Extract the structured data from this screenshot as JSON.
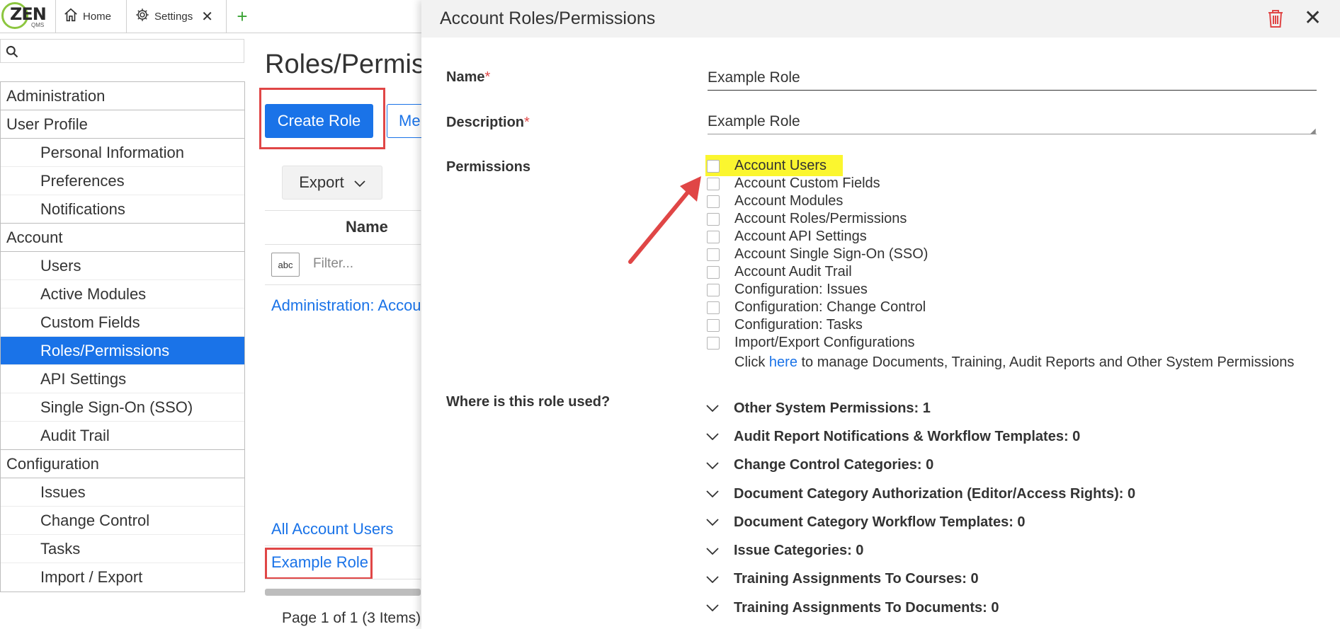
{
  "topbar": {
    "logo_text": "ZEN",
    "logo_sub": "QMS",
    "tabs": [
      {
        "label": "Home",
        "icon": "home-icon"
      },
      {
        "label": "Settings",
        "icon": "gear-icon"
      }
    ]
  },
  "sidebar": {
    "search_placeholder": "",
    "items": [
      {
        "label": "Administration"
      },
      {
        "label": "User Profile"
      },
      {
        "label": "Personal Information"
      },
      {
        "label": "Preferences"
      },
      {
        "label": "Notifications"
      },
      {
        "label": "Account"
      },
      {
        "label": "Users"
      },
      {
        "label": "Active Modules"
      },
      {
        "label": "Custom Fields"
      },
      {
        "label": "Roles/Permissions"
      },
      {
        "label": "API Settings"
      },
      {
        "label": "Single Sign-On (SSO)"
      },
      {
        "label": "Audit Trail"
      },
      {
        "label": "Configuration"
      },
      {
        "label": "Issues"
      },
      {
        "label": "Change Control"
      },
      {
        "label": "Tasks"
      },
      {
        "label": "Import / Export"
      }
    ]
  },
  "main": {
    "title": "Roles/Permiss",
    "create_button": "Create Role",
    "second_button": "Me",
    "export_button": "Export",
    "grid_header_name": "Name",
    "filter_icon_text": "abc",
    "filter_placeholder": "Filter...",
    "rows": [
      {
        "label": "Administration: Accou"
      },
      {
        "label": "All Account Users"
      },
      {
        "label": "Example Role"
      }
    ],
    "pager": "Page 1 of 1 (3 Items)"
  },
  "panel": {
    "title": "Account Roles/Permissions",
    "name_label": "Name",
    "description_label": "Description",
    "required_mark": "*",
    "name_value": "Example Role",
    "description_value": "Example Role",
    "permissions_label": "Permissions",
    "permissions": [
      {
        "label": "Account Users",
        "checked": false
      },
      {
        "label": "Account Custom Fields",
        "checked": false
      },
      {
        "label": "Account Modules",
        "checked": false
      },
      {
        "label": "Account Roles/Permissions",
        "checked": false
      },
      {
        "label": "Account API Settings",
        "checked": false
      },
      {
        "label": "Account Single Sign-On (SSO)",
        "checked": false
      },
      {
        "label": "Account Audit Trail",
        "checked": false
      },
      {
        "label": "Configuration: Issues",
        "checked": false
      },
      {
        "label": "Configuration: Change Control",
        "checked": false
      },
      {
        "label": "Configuration: Tasks",
        "checked": false
      },
      {
        "label": "Import/Export Configurations",
        "checked": false
      }
    ],
    "click_prefix": "Click",
    "click_link": "here",
    "click_suffix": "to manage Documents, Training, Audit Reports and Other System Permissions",
    "where_label": "Where is this role used?",
    "where_items": [
      {
        "label": "Other System Permissions: 1"
      },
      {
        "label": "Audit Report Notifications & Workflow Templates: 0"
      },
      {
        "label": "Change Control Categories: 0"
      },
      {
        "label": "Document Category Authorization (Editor/Access Rights): 0"
      },
      {
        "label": "Document Category Workflow Templates: 0"
      },
      {
        "label": "Issue Categories: 0"
      },
      {
        "label": "Training Assignments To Courses: 0"
      },
      {
        "label": "Training Assignments To Documents: 0"
      }
    ]
  },
  "colors": {
    "primary": "#1a73e8",
    "highlight": "#fbf62f",
    "annotation_red": "#e04646",
    "logo_green": "#8cc63f"
  }
}
